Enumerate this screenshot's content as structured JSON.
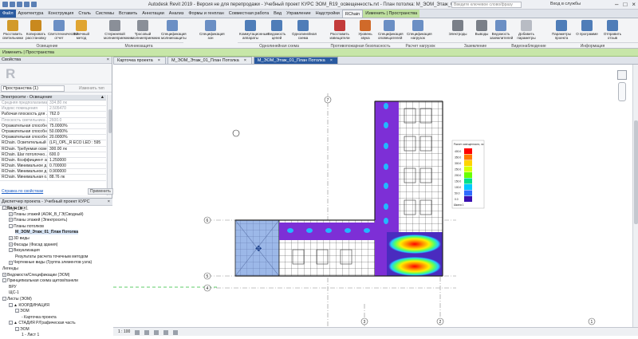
{
  "title": {
    "text": "Autodesk Revit 2019 - Версия не для перепродажи - Учебный проект КУРС ЭОМ_R19_освещенность.rvt - План потолка: М_ЭОМ_Этаж_01_План Потолка",
    "search_placeholder": "Введите ключевое слово/фразу",
    "user": "Вход в службы"
  },
  "ribbon_tabs": [
    "Файл",
    "Архитектура",
    "Конструкция",
    "Сталь",
    "Системы",
    "Вставить",
    "Аннотации",
    "Анализ",
    "Формы и генплан",
    "Совместная работа",
    "Вид",
    "Управление",
    "Надстройки",
    "RChain",
    "Изменить | Пространства"
  ],
  "ribbon": {
    "buttons": [
      {
        "label": "Расставить светильники",
        "icon": "lamp-place-icon",
        "color": "#d29a2a"
      },
      {
        "label": "Копировать расстановку",
        "icon": "copy-layout-icon",
        "color": "#c9891e"
      },
      {
        "label": "Светотехнический отчет",
        "icon": "report-icon",
        "color": "#6b8fc4"
      },
      {
        "label": "Точечный метод",
        "icon": "point-method-icon",
        "color": "#e0a532"
      },
      {
        "label": "Стержневой молниеприемник",
        "icon": "rod-lightning-icon",
        "color": "#8a8f98"
      },
      {
        "label": "Тросовый молниеприемник",
        "icon": "cable-lightning-icon",
        "color": "#8a8f98"
      },
      {
        "label": "Спецификация молниезащиты",
        "icon": "lightning-spec-icon",
        "color": "#6b8fc4"
      },
      {
        "label": "Спецификация зон",
        "icon": "zone-spec-icon",
        "color": "#6b8fc4"
      },
      {
        "label": "Коммутационные аппараты",
        "icon": "switchgear-icon",
        "color": "#4f7db8"
      },
      {
        "label": "Ведомость цепей",
        "icon": "circuit-list-icon",
        "color": "#4f7db8"
      },
      {
        "label": "Однолинейная схема",
        "icon": "single-line-icon",
        "color": "#4f7db8"
      },
      {
        "label": "Расставить извещатели",
        "icon": "detector-place-icon",
        "color": "#c33b3b"
      },
      {
        "label": "Уровень звука",
        "icon": "sound-level-icon",
        "color": "#d06a2a"
      },
      {
        "label": "Спецификация оповещателей",
        "icon": "alarm-spec-icon",
        "color": "#6b8fc4"
      },
      {
        "label": "Спецификация нагрузок",
        "icon": "load-spec-icon",
        "color": "#6b8fc4"
      },
      {
        "label": "Электроды",
        "icon": "electrode-icon",
        "color": "#7a7f88"
      },
      {
        "label": "Выводы",
        "icon": "terminal-icon",
        "color": "#7a7f88"
      },
      {
        "label": "Ведомость заземлителей",
        "icon": "ground-list-icon",
        "color": "#6b8fc4"
      },
      {
        "label": "Добавить параметры",
        "icon": "add-params-icon",
        "color": "#b8bcc4"
      },
      {
        "label": "Параметры проекта",
        "icon": "project-params-icon",
        "color": "#4f7db8"
      },
      {
        "label": "О программе",
        "icon": "about-icon",
        "color": "#4f7db8"
      },
      {
        "label": "Отправить отзыв",
        "icon": "feedback-icon",
        "color": "#4f7db8"
      }
    ],
    "groups": [
      "Освещение",
      "Молниезащита",
      "Однолинейная схема",
      "Противопожарная безопасность",
      "Расчет нагрузок",
      "Заземление",
      "Видеонаблюдение",
      "Информация"
    ]
  },
  "context_bar": "Изменить | Пространства",
  "properties": {
    "header": "Свойства",
    "selector": "Пространства (1)",
    "edit_type": "Изменить тип",
    "section": "Электросети - Освещение",
    "rows": [
      {
        "name": "Средняя предполагаема...",
        "value": "334,80 лк",
        "gray": true
      },
      {
        "name": "Индекс помещения",
        "value": "2.505470",
        "gray": true
      },
      {
        "name": "Рабочая плоскость для ...",
        "value": "762.0",
        "gray": false
      },
      {
        "name": "Плоскость светильника ...",
        "value": "2600.0",
        "gray": true
      },
      {
        "name": "Отражательная способн...",
        "value": "75.0000%",
        "gray": false
      },
      {
        "name": "Отражательная способн...",
        "value": "50.0000%",
        "gray": false
      },
      {
        "name": "Отражательная способн...",
        "value": "20.0000%",
        "gray": false
      },
      {
        "name": "RChain. Осветительный ...",
        "value": "(LF)_OPL_R ECO LED : 595",
        "gray": false
      },
      {
        "name": "RChain. Требуемая осве...",
        "value": "300.00 лк",
        "gray": false
      },
      {
        "name": "RChain. Шаг потолочно...",
        "value": "600.0",
        "gray": false
      },
      {
        "name": "RChain. Коэффициент за...",
        "value": "1.250000",
        "gray": false
      },
      {
        "name": "RChain. Минимальное д...",
        "value": "0.700000",
        "gray": false
      },
      {
        "name": "RChain. Минимальное д...",
        "value": "0.900000",
        "gray": false
      },
      {
        "name": "RChain. Минимальная о...",
        "value": "88.76 лк",
        "gray": false
      }
    ],
    "help_link": "Справка по свойствам",
    "apply": "Применить"
  },
  "browser": {
    "header": "Диспетчер проекта - Учебный проект КУРС ЭОМ_R19_...",
    "nodes": [
      {
        "label": "Виды (все)",
        "level": 0,
        "toggle": "-"
      },
      {
        "label": "Планы этажей (АОЖ_В_ГЭ(Сводный)",
        "level": 1,
        "toggle": "+"
      },
      {
        "label": "Планы этажей (Электросеть)",
        "level": 1,
        "toggle": "+"
      },
      {
        "label": "Планы потолков",
        "level": 1,
        "toggle": "-"
      },
      {
        "label": "М_ЭОМ_Этаж_01_План Потолка",
        "level": 2,
        "toggle": "",
        "selected": true
      },
      {
        "label": "3D виды",
        "level": 1,
        "toggle": "+"
      },
      {
        "label": "Фасады (Фасад здания)",
        "level": 1,
        "toggle": "+"
      },
      {
        "label": "Визуализация",
        "level": 1,
        "toggle": "-"
      },
      {
        "label": "Результаты расчета точечным методом",
        "level": 2,
        "toggle": ""
      },
      {
        "label": "Чертежные виды (Группа элементов узла)",
        "level": 1,
        "toggle": "+"
      },
      {
        "label": "Легенды",
        "level": 0,
        "toggle": ""
      },
      {
        "label": "Ведомости/Спецификации (ЭОМ)",
        "level": 0,
        "toggle": "+"
      },
      {
        "label": "Принципиальная схема щитов/панели",
        "level": 0,
        "toggle": "-"
      },
      {
        "label": "ВРУ",
        "level": 1,
        "toggle": ""
      },
      {
        "label": "ЩС-1",
        "level": 1,
        "toggle": ""
      },
      {
        "label": "Листы (ЭОМ)",
        "level": 0,
        "toggle": "-"
      },
      {
        "label": "▲ КООРДИНАЦИЯ",
        "level": 1,
        "toggle": "-"
      },
      {
        "label": "ЭОМ",
        "level": 2,
        "toggle": "-"
      },
      {
        "label": "- Карточка проекта",
        "level": 3,
        "toggle": ""
      },
      {
        "label": "▲ СТАДИЯ Р/Графическая часть",
        "level": 1,
        "toggle": "-"
      },
      {
        "label": "ЭОМ",
        "level": 2,
        "toggle": "-"
      },
      {
        "label": "1 - Лист 1",
        "level": 3,
        "toggle": ""
      }
    ]
  },
  "doc_tabs": [
    {
      "label": "Карточка проекта",
      "active": false
    },
    {
      "label": "М_ЭОМ_Этаж_01_План Потолка",
      "active": false
    },
    {
      "label": "М_ЭОМ_Этаж_01_План Потолка",
      "active": true
    }
  ],
  "grid_labels": {
    "top": "7",
    "row1": "6",
    "row2": "5",
    "row3": "4",
    "bottom": [
      "3",
      "2",
      "1"
    ]
  },
  "legend": {
    "title": "Расчет освещенности, лк",
    "values": [
      "400.0",
      "350.0",
      "300.0",
      "250.0",
      "200.0",
      "150.0",
      "100.0",
      "50.0",
      "0.0"
    ],
    "colors": [
      "#ff0000",
      "#ff7a00",
      "#ffd400",
      "#d8ff00",
      "#6aff00",
      "#00e08a",
      "#00c8ff",
      "#2f6bff",
      "#3a0fb0"
    ],
    "footer": "Шкала 1"
  },
  "status": {
    "scale": "1 : 100"
  },
  "colors": {
    "accent": "#2a5aa0",
    "ctx": "#c7e6a8",
    "floor": "#7d2fd6",
    "cool": "#4a2bbf"
  }
}
